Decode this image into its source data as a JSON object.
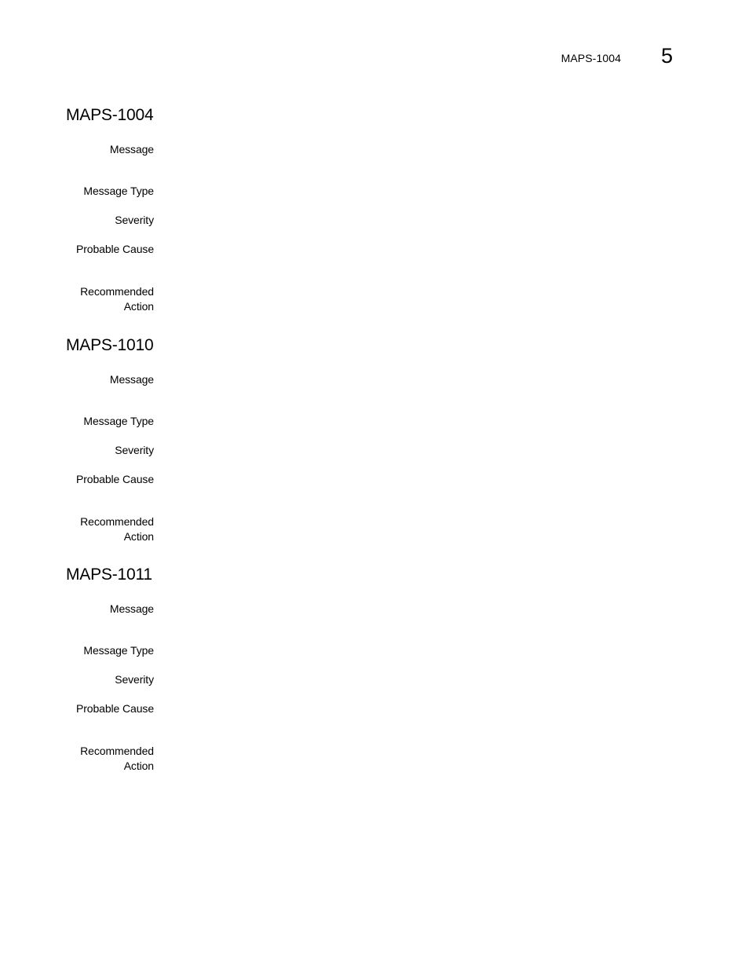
{
  "running_header": {
    "title": "MAPS-1004",
    "chapter": "5"
  },
  "sections": [
    {
      "title": "MAPS-1004",
      "fields": {
        "message": {
          "label": "Message",
          "value": ""
        },
        "message_type": {
          "label": "Message Type",
          "value": ""
        },
        "severity": {
          "label": "Severity",
          "value": ""
        },
        "probable_cause": {
          "label": "Probable Cause",
          "value": ""
        },
        "recommended_action": {
          "label_line1": "Recommended",
          "label_line2": "Action",
          "value": ""
        }
      }
    },
    {
      "title": "MAPS-1010",
      "fields": {
        "message": {
          "label": "Message",
          "value": ""
        },
        "message_type": {
          "label": "Message Type",
          "value": ""
        },
        "severity": {
          "label": "Severity",
          "value": ""
        },
        "probable_cause": {
          "label": "Probable Cause",
          "value": ""
        },
        "recommended_action": {
          "label_line1": "Recommended",
          "label_line2": "Action",
          "value": ""
        }
      }
    },
    {
      "title": "MAPS-1011",
      "fields": {
        "message": {
          "label": "Message",
          "value": ""
        },
        "message_type": {
          "label": "Message Type",
          "value": ""
        },
        "severity": {
          "label": "Severity",
          "value": ""
        },
        "probable_cause": {
          "label": "Probable Cause",
          "value": ""
        },
        "recommended_action": {
          "label_line1": "Recommended",
          "label_line2": "Action",
          "value": ""
        }
      }
    }
  ]
}
